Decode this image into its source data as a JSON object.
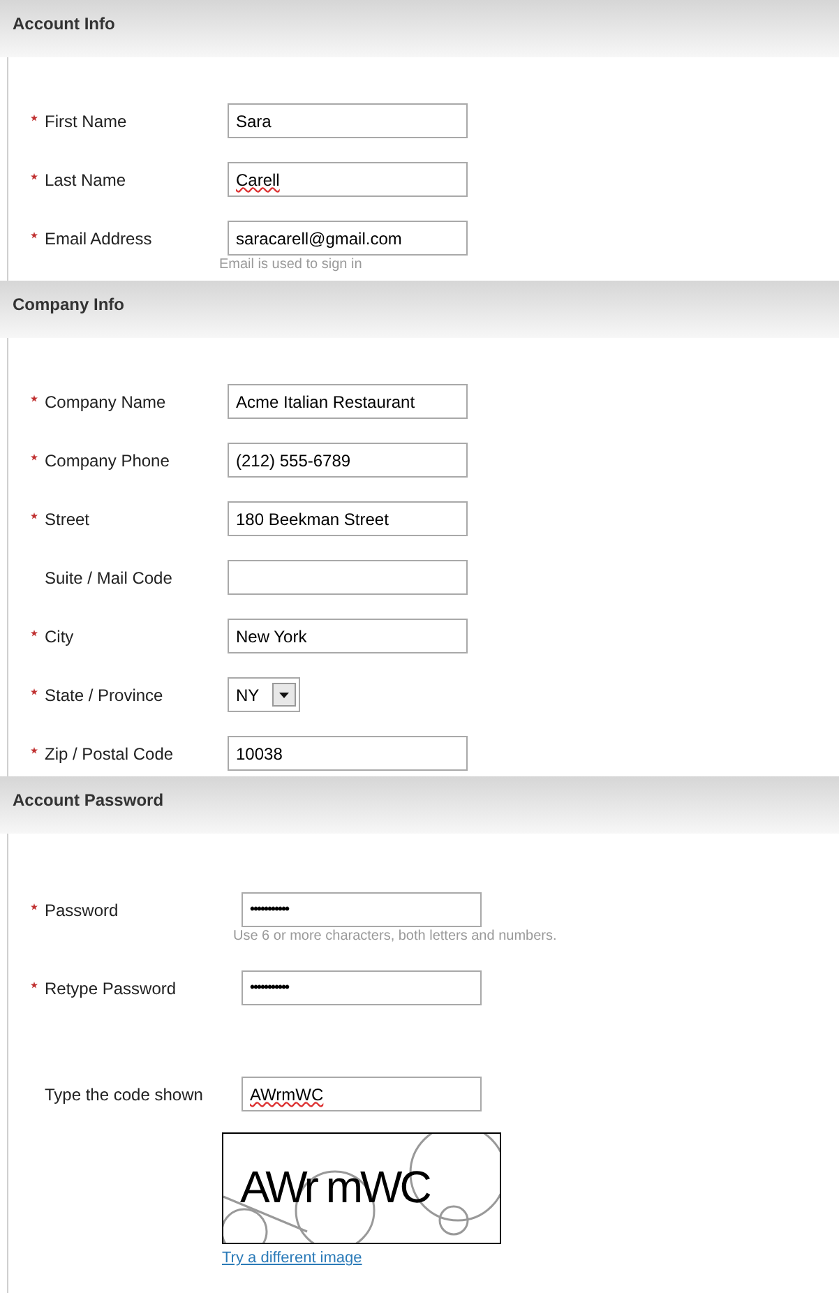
{
  "sections": [
    {
      "title": "Account Info",
      "fields": [
        {
          "kind": "text",
          "label": "First Name",
          "required": true,
          "value": "Sara"
        },
        {
          "kind": "text",
          "label": "Last Name",
          "required": true,
          "value": "Carell",
          "misspelled": true
        },
        {
          "kind": "text",
          "label": "Email Address",
          "required": true,
          "value": "saracarell@gmail.com",
          "hint": "Email is used to sign in"
        }
      ]
    },
    {
      "title": "Company Info",
      "fields": [
        {
          "kind": "text",
          "label": "Company Name",
          "required": true,
          "value": "Acme Italian Restaurant"
        },
        {
          "kind": "text",
          "label": "Company Phone",
          "required": true,
          "value": "(212) 555-6789"
        },
        {
          "kind": "text",
          "label": "Street",
          "required": true,
          "value": "180 Beekman Street"
        },
        {
          "kind": "text",
          "label": "Suite / Mail Code",
          "required": false
        },
        {
          "kind": "text",
          "label": "City",
          "required": true,
          "value": "New York"
        },
        {
          "kind": "select",
          "label": "State / Province",
          "required": true,
          "value": "NY"
        },
        {
          "kind": "text",
          "label": "Zip / Postal Code",
          "required": true,
          "value": "10038"
        }
      ]
    },
    {
      "title": "Account Password",
      "fields": [
        {
          "kind": "password",
          "label": "Password",
          "required": true,
          "value": "•••••••••••",
          "hint": "Use 6 or more characters, both letters and numbers."
        },
        {
          "kind": "password",
          "label": "Retype Password",
          "required": true,
          "value": "•••••••••••"
        },
        {
          "kind": "captcha",
          "label": "Type the code shown",
          "required": false,
          "value": "AWrmWC",
          "misspelled": true,
          "captcha_text": "AWr mWC",
          "link": "Try a different image"
        }
      ]
    }
  ]
}
